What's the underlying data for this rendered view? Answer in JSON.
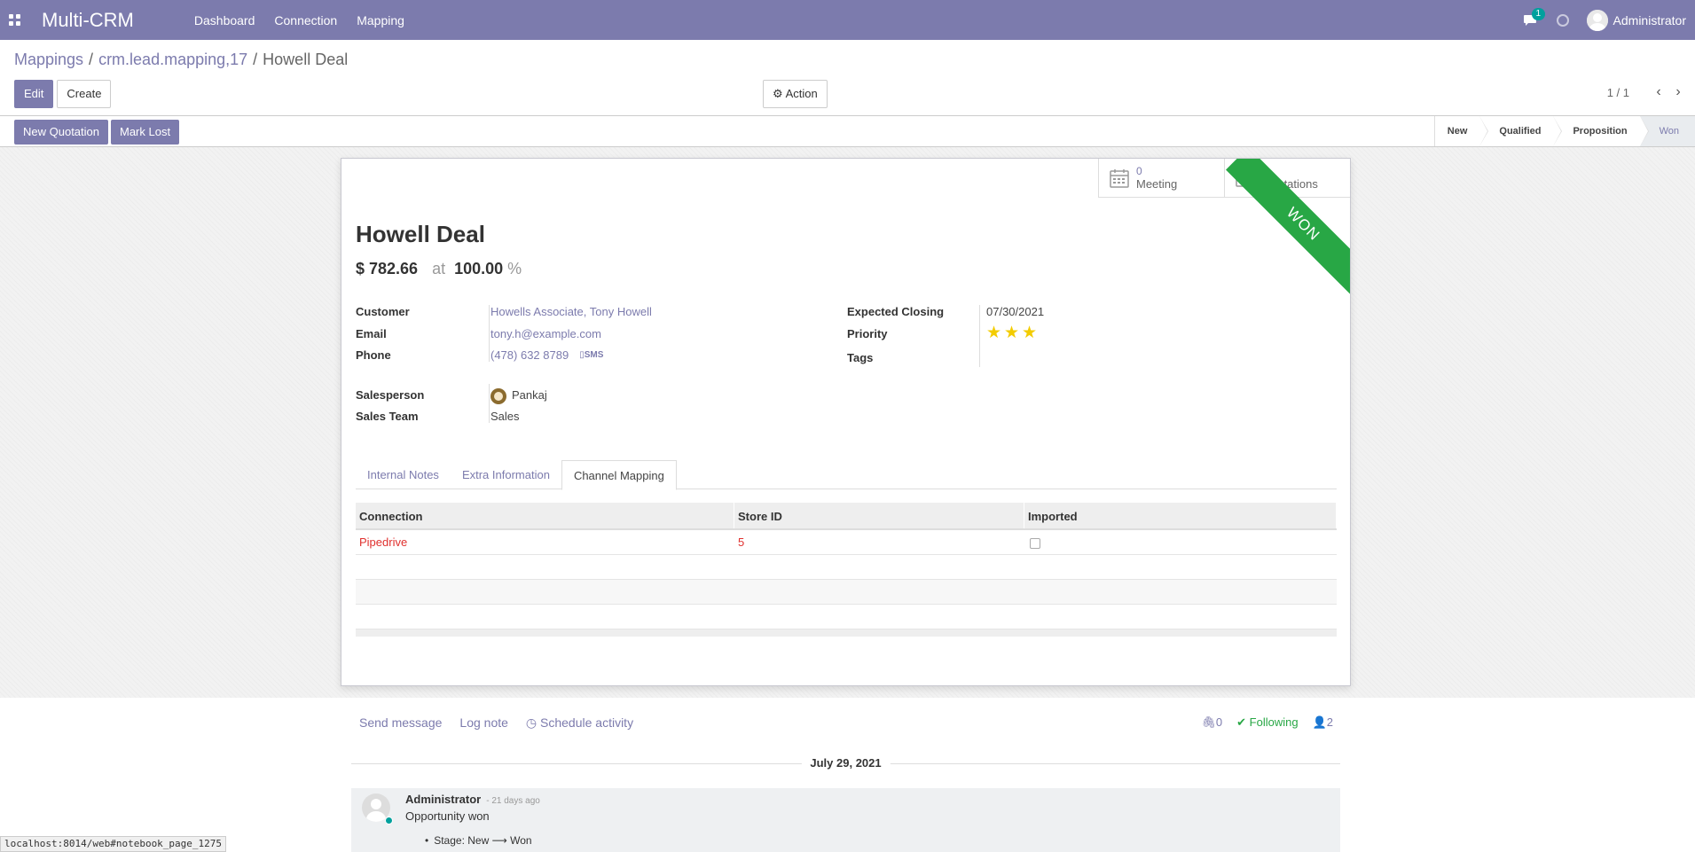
{
  "topbar": {
    "brand": "Multi-CRM",
    "nav": [
      "Dashboard",
      "Connection",
      "Mapping"
    ],
    "chat_badge": "1",
    "username": "Administrator"
  },
  "breadcrumb": [
    "Mappings",
    "crm.lead.mapping,17",
    "Howell Deal"
  ],
  "buttons": {
    "edit": "Edit",
    "create": "Create",
    "action": "Action"
  },
  "pager": {
    "value": "1 / 1"
  },
  "statusbar": {
    "new_quotation": "New Quotation",
    "mark_lost": "Mark Lost",
    "stages": [
      "New",
      "Qualified",
      "Proposition",
      "Won"
    ],
    "active_stage": "Won"
  },
  "smart_buttons": {
    "meeting": {
      "count": "0",
      "label": "Meeting"
    },
    "quotations": {
      "count": "0",
      "label": "Quotations"
    }
  },
  "ribbon": "WON",
  "record": {
    "title": "Howell Deal",
    "revenue": "$ 782.66",
    "at": "at",
    "probability": "100.00",
    "pct_sign": "%"
  },
  "fields": {
    "customer": {
      "label": "Customer",
      "value": "Howells Associate, Tony Howell"
    },
    "email": {
      "label": "Email",
      "value": "tony.h@example.com"
    },
    "phone": {
      "label": "Phone",
      "value": "(478) 632 8789",
      "sms": "SMS"
    },
    "salesperson": {
      "label": "Salesperson",
      "value": "Pankaj"
    },
    "sales_team": {
      "label": "Sales Team",
      "value": "Sales"
    },
    "expected_closing": {
      "label": "Expected Closing",
      "value": "07/30/2021"
    },
    "priority": {
      "label": "Priority",
      "stars": 3,
      "max": 3
    },
    "tags": {
      "label": "Tags",
      "value": ""
    }
  },
  "tabs": [
    "Internal Notes",
    "Extra Information",
    "Channel Mapping"
  ],
  "active_tab": "Channel Mapping",
  "table": {
    "headers": [
      "Connection",
      "Store ID",
      "Imported"
    ],
    "rows": [
      {
        "connection": "Pipedrive",
        "store_id": "5",
        "imported": false
      }
    ]
  },
  "chatter": {
    "send_message": "Send message",
    "log_note": "Log note",
    "schedule_activity": "Schedule activity",
    "attachments": "0",
    "following": "Following",
    "followers": "2",
    "date": "July 29, 2021",
    "message": {
      "author": "Administrator",
      "time": "- 21 days ago",
      "body": "Opportunity won",
      "tracking": "Stage: New ⟶ Won"
    }
  },
  "status_url": "localhost:8014/web#notebook_page_1275",
  "colors": {
    "brand": "#7c7bad",
    "won": "#28a745",
    "link_red": "#e0302e",
    "star": "#f3cc00"
  }
}
